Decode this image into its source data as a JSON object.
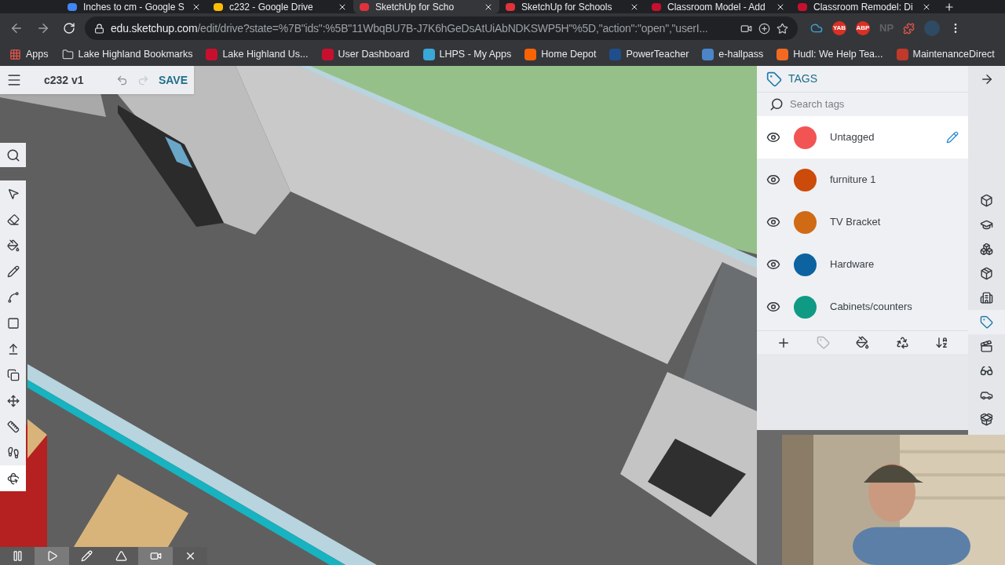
{
  "browser": {
    "tabs": [
      {
        "title": "Inches to cm - Google S",
        "color": "#4285f4",
        "selected": false
      },
      {
        "title": "c232 - Google Drive",
        "color": "#fbbc04",
        "selected": false
      },
      {
        "title": "SketchUp for Scho",
        "color": "#e0323a",
        "selected": true
      },
      {
        "title": "SketchUp for Schools",
        "color": "#e0323a",
        "selected": false
      },
      {
        "title": "Classroom Model - Add",
        "color": "#c8102e",
        "selected": false
      },
      {
        "title": "Classroom Remodel: Di",
        "color": "#c8102e",
        "selected": false
      }
    ],
    "address": {
      "domain": "edu.sketchup.com",
      "path": "/edit/drive?state=%7B\"ids\":%5B\"11WbqBU7B-J7K6hGeDsAtUiAbNDKSWP5H\"%5D,\"action\":\"open\",\"userI..."
    },
    "extensions": [
      {
        "label": "YAB",
        "color": "#d93025"
      },
      {
        "label": "ABP",
        "color": "#d93025"
      },
      {
        "label": "NP",
        "color": "#5f6368"
      }
    ],
    "bookmarks": [
      {
        "kind": "apps",
        "label": "Apps"
      },
      {
        "kind": "folder",
        "label": "Lake Highland Bookmarks"
      },
      {
        "kind": "site",
        "label": "Lake Highland Us...",
        "color": "#c8102e"
      },
      {
        "kind": "site",
        "label": "User Dashboard",
        "color": "#c8102e"
      },
      {
        "kind": "site",
        "label": "LHPS - My Apps",
        "color": "#3aa7d8"
      },
      {
        "kind": "site",
        "label": "Home Depot",
        "color": "#f96302"
      },
      {
        "kind": "site",
        "label": "PowerTeacher",
        "color": "#1f4e8c"
      },
      {
        "kind": "site",
        "label": "e-hallpass",
        "color": "#4a86c8"
      },
      {
        "kind": "site",
        "label": "Hudl: We Help Tea...",
        "color": "#f26a21"
      },
      {
        "kind": "site",
        "label": "MaintenanceDirect",
        "color": "#c0392b"
      }
    ]
  },
  "app": {
    "file_title": "c232 v1",
    "save": "SAVE",
    "tools": [
      {
        "kind": "select",
        "selected": false
      },
      {
        "kind": "eraser",
        "selected": false
      },
      {
        "kind": "paint",
        "selected": false
      },
      {
        "kind": "pencil",
        "selected": false
      },
      {
        "kind": "arc",
        "selected": false
      },
      {
        "kind": "rectangle",
        "selected": false
      },
      {
        "kind": "pushpull",
        "selected": false
      },
      {
        "kind": "offset",
        "selected": false
      },
      {
        "kind": "move",
        "selected": false
      },
      {
        "kind": "tape",
        "selected": false
      },
      {
        "kind": "walk",
        "selected": false
      },
      {
        "kind": "orbit",
        "selected": true
      }
    ],
    "rail": [
      {
        "kind": "entity",
        "selected": false
      },
      {
        "kind": "instructor",
        "selected": false
      },
      {
        "kind": "components",
        "selected": false
      },
      {
        "kind": "materials",
        "selected": false
      },
      {
        "kind": "styles",
        "selected": false
      },
      {
        "kind": "tags",
        "selected": true
      },
      {
        "kind": "scenes",
        "selected": false
      },
      {
        "kind": "display",
        "selected": false
      },
      {
        "kind": "info",
        "selected": false
      },
      {
        "kind": "solid",
        "selected": false
      }
    ],
    "tags_panel": {
      "title": "TAGS",
      "search": {
        "placeholder": "Search tags"
      },
      "tags": [
        {
          "name": "Untagged",
          "color": "#f25454",
          "visible": true,
          "selected": true
        },
        {
          "name": "furniture 1",
          "color": "#cc4a0a",
          "visible": true,
          "selected": false
        },
        {
          "name": "TV Bracket",
          "color": "#d06a14",
          "visible": true,
          "selected": false
        },
        {
          "name": "Hardware",
          "color": "#0c63a0",
          "visible": true,
          "selected": false
        },
        {
          "name": "Cabinets/counters",
          "color": "#0f9a84",
          "visible": true,
          "selected": false
        }
      ]
    }
  }
}
